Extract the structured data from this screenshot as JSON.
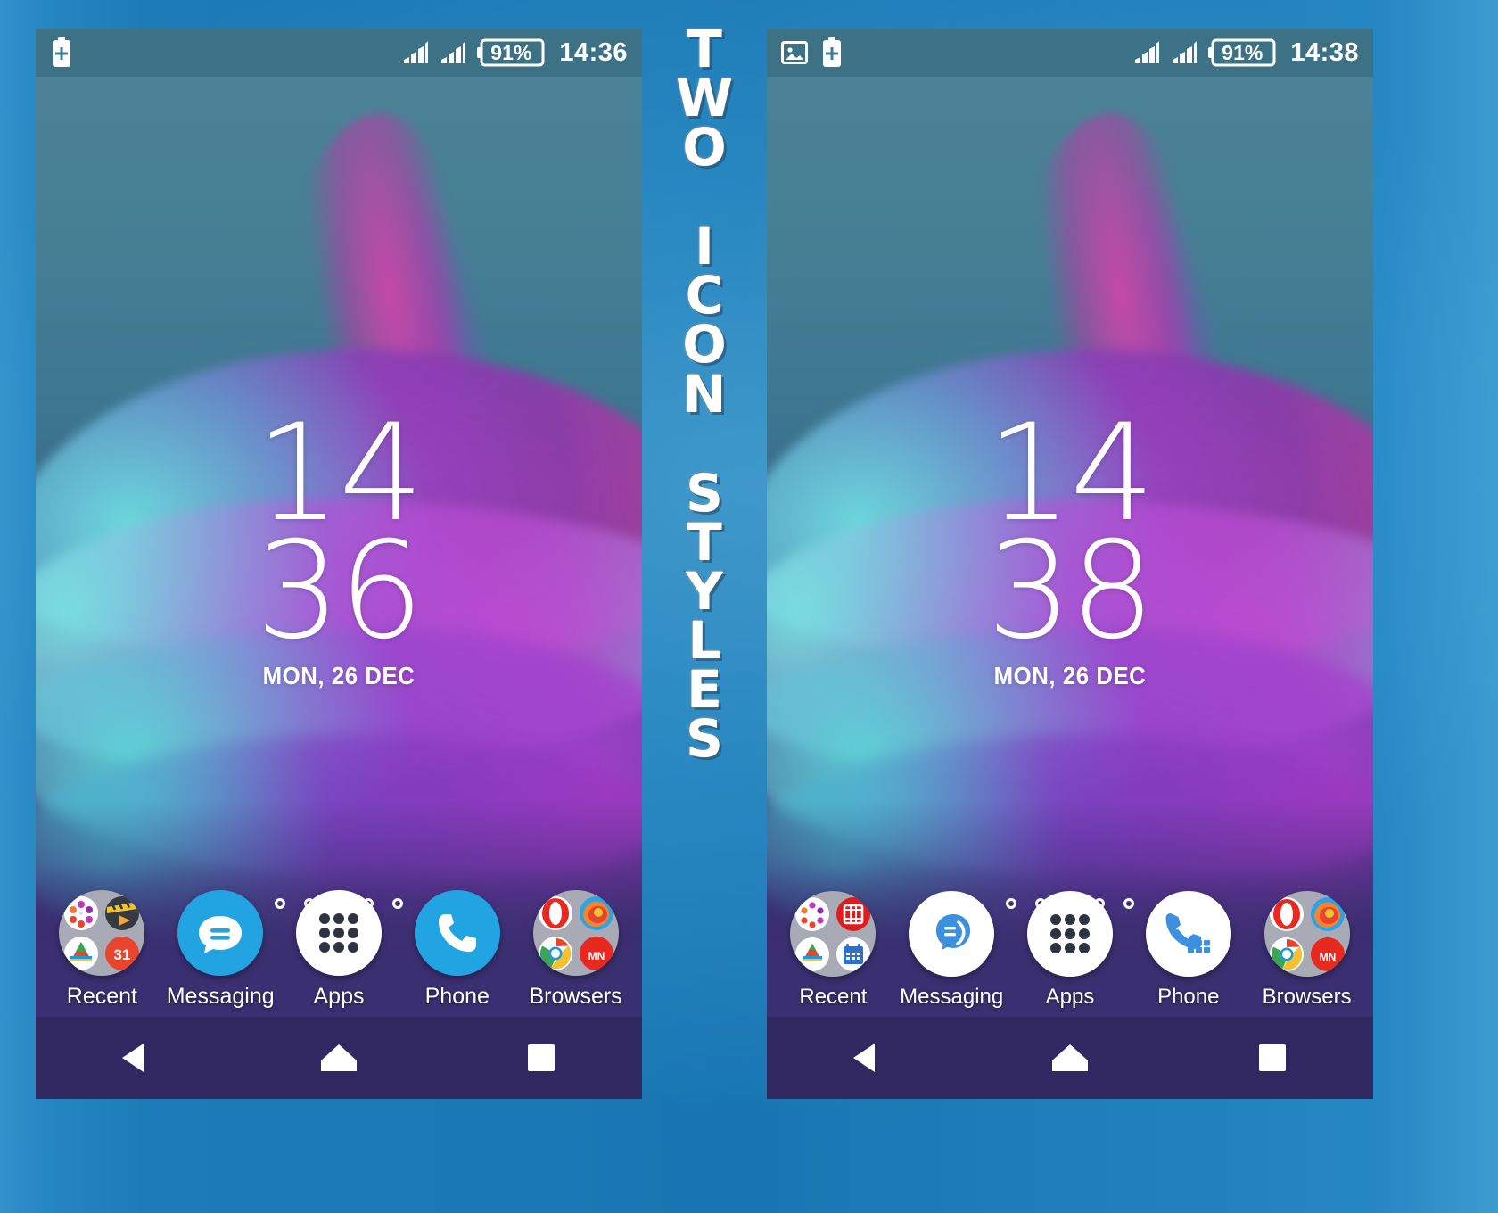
{
  "banner": {
    "lines": [
      "TWO",
      "ICON",
      "STYLES"
    ]
  },
  "colors": {
    "accent_blue": "#22a3e2",
    "frame_blue": "#1f7fbc",
    "status_bar": "#3d7f95",
    "folder_grey": "#a8aab5",
    "nav_bar": "#2c2355",
    "text_white": "#ffffff"
  },
  "panels": [
    {
      "id": "left-phone",
      "style_name": "flat-icon-style",
      "status_bar": {
        "left_icons": [
          "battery-plus-icon"
        ],
        "right_icons": [
          "signal-bars-sim1-icon",
          "signal-bars-sim2-icon"
        ],
        "battery_percent": "91%",
        "clock": "14:36"
      },
      "clock_widget": {
        "hours": "14",
        "minutes": "36",
        "date": "MON, 26 DEC"
      },
      "page_indicator": {
        "count": 5,
        "active_index": 2
      },
      "dock": [
        {
          "label": "Recent",
          "icon": "folder-recent-icon"
        },
        {
          "label": "Messaging",
          "icon": "messaging-icon"
        },
        {
          "label": "Apps",
          "icon": "app-drawer-icon"
        },
        {
          "label": "Phone",
          "icon": "phone-icon"
        },
        {
          "label": "Browsers",
          "icon": "folder-browsers-icon"
        }
      ],
      "nav_bar": [
        "back-icon",
        "home-icon",
        "recents-icon"
      ]
    },
    {
      "id": "right-phone",
      "style_name": "outline-icon-style",
      "status_bar": {
        "left_icons": [
          "photo-icon",
          "battery-plus-icon"
        ],
        "right_icons": [
          "signal-bars-sim1-icon",
          "signal-bars-sim2-icon"
        ],
        "battery_percent": "91%",
        "clock": "14:38"
      },
      "clock_widget": {
        "hours": "14",
        "minutes": "38",
        "date": "MON, 26 DEC"
      },
      "page_indicator": {
        "count": 5,
        "active_index": 2
      },
      "dock": [
        {
          "label": "Recent",
          "icon": "folder-recent-icon"
        },
        {
          "label": "Messaging",
          "icon": "messaging-icon"
        },
        {
          "label": "Apps",
          "icon": "app-drawer-icon"
        },
        {
          "label": "Phone",
          "icon": "phone-icon"
        },
        {
          "label": "Browsers",
          "icon": "folder-browsers-icon"
        }
      ],
      "nav_bar": [
        "back-icon",
        "home-icon",
        "recents-icon"
      ]
    }
  ]
}
